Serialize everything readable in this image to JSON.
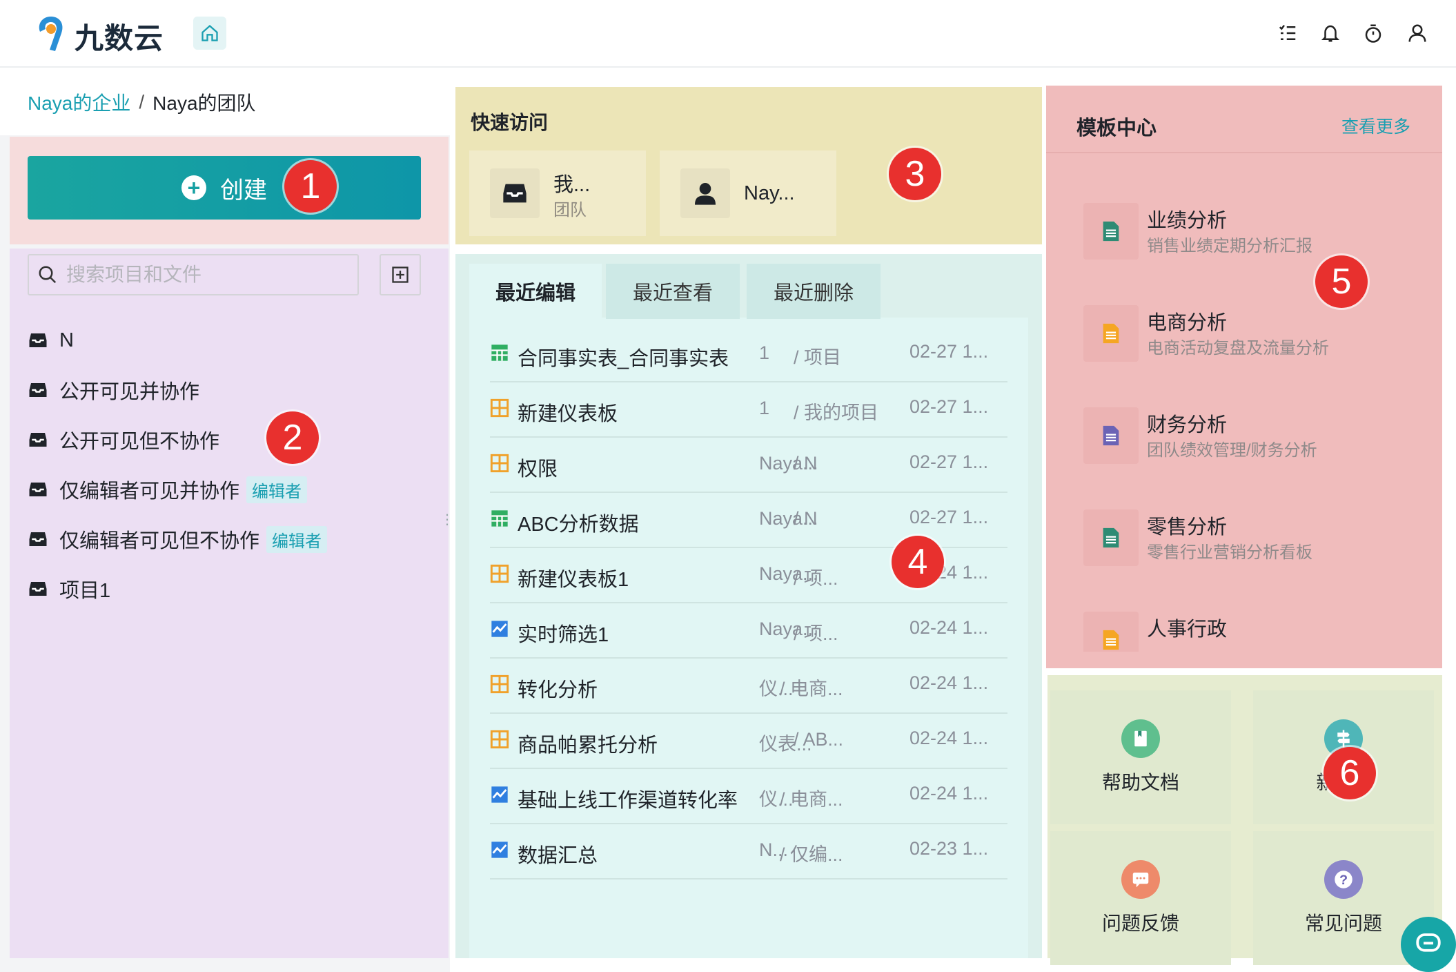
{
  "header": {
    "app_name": "九数云",
    "icons": [
      "task-list-icon",
      "bell-icon",
      "timer-icon",
      "user-icon"
    ]
  },
  "breadcrumb": {
    "enterprise": "Naya的企业",
    "separator": "/",
    "team": "Naya的团队"
  },
  "create_button": {
    "label": "创建"
  },
  "search": {
    "placeholder": "搜索项目和文件"
  },
  "projects": [
    {
      "name": "N",
      "tag": ""
    },
    {
      "name": "公开可见并协作",
      "tag": ""
    },
    {
      "name": "公开可见但不协作",
      "tag": ""
    },
    {
      "name": "仅编辑者可见并协作",
      "tag": "编辑者"
    },
    {
      "name": "仅编辑者可见但不协作",
      "tag": "编辑者"
    },
    {
      "name": "项目1",
      "tag": ""
    }
  ],
  "quick_access": {
    "title": "快速访问",
    "cards": [
      {
        "title": "我...",
        "subtitle": "团队",
        "icon": "inbox-icon"
      },
      {
        "title": "Nay...",
        "subtitle": "",
        "icon": "user-avatar-icon"
      }
    ]
  },
  "recent": {
    "tabs": [
      "最近编辑",
      "最近查看",
      "最近删除"
    ],
    "active_tab": "最近编辑",
    "rows": [
      {
        "icon": "sheet",
        "name": "合同事实表_合同事实表",
        "creator": "1",
        "path": "/ 项目",
        "time": "02-27 1..."
      },
      {
        "icon": "dashboard",
        "name": "新建仪表板",
        "creator": "1",
        "path": "/ 我的项目",
        "time": "02-27 1..."
      },
      {
        "icon": "dashboard",
        "name": "权限",
        "creator": "Naya...",
        "path": "/ N",
        "time": "02-27 1..."
      },
      {
        "icon": "sheet",
        "name": "ABC分析数据",
        "creator": "Naya...",
        "path": "/ N",
        "time": "02-27 1..."
      },
      {
        "icon": "dashboard",
        "name": "新建仪表板1",
        "creator": "Naya...",
        "path": "/ 项...",
        "time": "02-24 1..."
      },
      {
        "icon": "chart",
        "name": "实时筛选1",
        "creator": "Naya...",
        "path": "/ 项...",
        "time": "02-24 1..."
      },
      {
        "icon": "dashboard",
        "name": "转化分析",
        "creator": "仪...",
        "path": "/ 电商...",
        "time": "02-24 1..."
      },
      {
        "icon": "dashboard",
        "name": "商品帕累托分析",
        "creator": "仪表...",
        "path": "/ AB...",
        "time": "02-24 1..."
      },
      {
        "icon": "chart",
        "name": "基础上线工作渠道转化率",
        "creator": "仪...",
        "path": "/ 电商...",
        "time": "02-24 1..."
      },
      {
        "icon": "chart",
        "name": "数据汇总",
        "creator": "N...",
        "path": "/ 仅编...",
        "time": "02-23 1..."
      }
    ]
  },
  "templates": {
    "title": "模板中心",
    "more": "查看更多",
    "items": [
      {
        "name": "业绩分析",
        "desc": "销售业绩定期分析汇报",
        "color": "#2e8b74"
      },
      {
        "name": "电商分析",
        "desc": "电商活动复盘及流量分析",
        "color": "#f5a623"
      },
      {
        "name": "财务分析",
        "desc": "团队绩效管理/财务分析",
        "color": "#6b63b5"
      },
      {
        "name": "零售分析",
        "desc": "零售行业营销分析看板",
        "color": "#2e8b74"
      },
      {
        "name": "人事行政",
        "desc": "",
        "color": "#f5a623"
      }
    ]
  },
  "help": [
    {
      "label": "帮助文档",
      "icon": "book-icon"
    },
    {
      "label": "新...门",
      "icon": "signpost-icon"
    },
    {
      "label": "问题反馈",
      "icon": "feedback-icon"
    },
    {
      "label": "常见问题",
      "icon": "question-icon"
    }
  ],
  "badges": [
    "1",
    "2",
    "3",
    "4",
    "5",
    "6"
  ],
  "colors": {
    "accent": "#1a9fb1",
    "badge": "#e8302e"
  }
}
